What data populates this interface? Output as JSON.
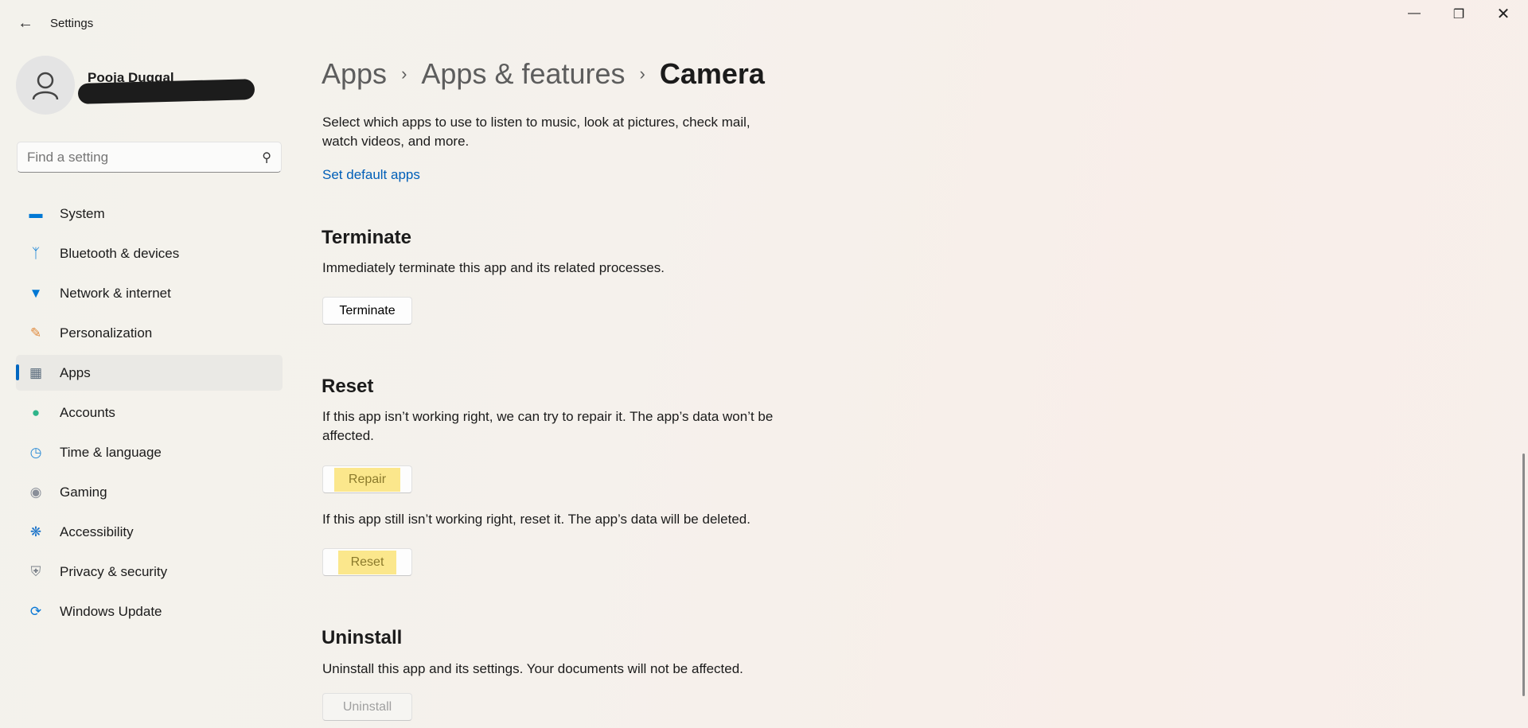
{
  "window": {
    "title": "Settings",
    "controls": [
      "minimize",
      "maximize",
      "close"
    ]
  },
  "user": {
    "name": "Pooja Duggal"
  },
  "search": {
    "placeholder": "Find a setting"
  },
  "sidebar": {
    "items": [
      {
        "label": "System",
        "icon": "monitor-icon",
        "color": "#0078d4"
      },
      {
        "label": "Bluetooth & devices",
        "icon": "bluetooth-icon",
        "color": "#0078d4"
      },
      {
        "label": "Network & internet",
        "icon": "wifi-icon",
        "color": "#0078d4"
      },
      {
        "label": "Personalization",
        "icon": "brush-icon",
        "color": "#e08a3c"
      },
      {
        "label": "Apps",
        "icon": "apps-icon",
        "color": "#5a6b7c",
        "selected": true
      },
      {
        "label": "Accounts",
        "icon": "person-icon",
        "color": "#2fb58a"
      },
      {
        "label": "Time & language",
        "icon": "clock-globe-icon",
        "color": "#2a8bd6"
      },
      {
        "label": "Gaming",
        "icon": "gamepad-icon",
        "color": "#8a8f99"
      },
      {
        "label": "Accessibility",
        "icon": "accessibility-icon",
        "color": "#1a73c9"
      },
      {
        "label": "Privacy & security",
        "icon": "shield-icon",
        "color": "#7a8088"
      },
      {
        "label": "Windows Update",
        "icon": "update-icon",
        "color": "#0a78d6"
      }
    ]
  },
  "breadcrumb": [
    "Apps",
    "Apps & features",
    "Camera"
  ],
  "main": {
    "intro": "Select which apps to use to listen to music, look at pictures, check mail, watch videos, and more.",
    "default_link": "Set default apps",
    "terminate": {
      "heading": "Terminate",
      "desc": "Immediately terminate this app and its related processes.",
      "button": "Terminate"
    },
    "reset": {
      "heading": "Reset",
      "desc1": "If this app isn’t working right, we can try to repair it. The app’s data won’t be affected.",
      "repair_button": "Repair",
      "desc2": "If this app still isn’t working right, reset it. The app’s data will be deleted.",
      "reset_button": "Reset"
    },
    "uninstall": {
      "heading": "Uninstall",
      "desc": "Uninstall this app and its settings. Your documents will not be affected.",
      "button": "Uninstall"
    }
  },
  "colors": {
    "accent": "#0067c0",
    "highlight": "#fbe78c"
  }
}
